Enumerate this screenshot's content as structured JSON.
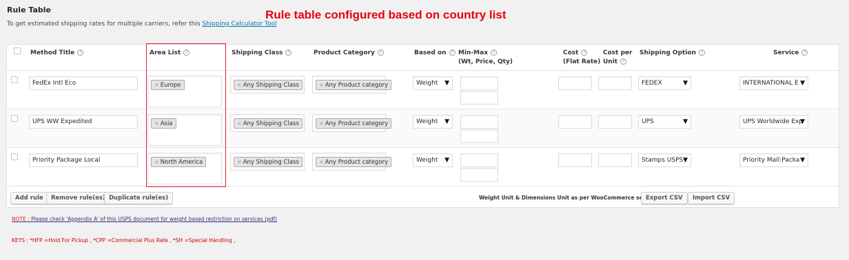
{
  "page": {
    "title": "Rule Table",
    "annotation": "Rule table configured based on country list",
    "description_prefix": "To get estimated shipping rates for multiple carriers, refer this ",
    "description_link": "Shipping Calculator Tool"
  },
  "table": {
    "headers": {
      "method_title": "Method Title",
      "area_list": "Area List",
      "shipping_class": "Shipping Class",
      "product_category": "Product Category",
      "based_on": "Based on",
      "min_max_line1": "Min-Max",
      "min_max_line2": "(Wt, Price, Qty)",
      "cost_line1": "Cost",
      "cost_line2": "(Flat Rate)",
      "cost_per_unit_line1": "Cost per",
      "cost_per_unit_line2": "Unit",
      "shipping_option": "Shipping Option",
      "service": "Service"
    },
    "help_glyph": "?",
    "rows": [
      {
        "method_title": "FedEx Intl Eco",
        "area": "Europe",
        "shipping_class": "Any Shipping Class",
        "product_category": "Any Product category",
        "based_on": "Weight",
        "shipping_option": "FEDEX",
        "service": "INTERNATIONAL E"
      },
      {
        "method_title": "UPS WW Expedited",
        "area": "Asia",
        "shipping_class": "Any Shipping Class",
        "product_category": "Any Product category",
        "based_on": "Weight",
        "shipping_option": "UPS",
        "service": "UPS Worldwide Exp"
      },
      {
        "method_title": "Priority Package Local",
        "area": "North America",
        "shipping_class": "Any Shipping Class",
        "product_category": "Any Product category",
        "based_on": "Weight",
        "shipping_option": "Stamps USPS",
        "service": "Priority Mail:Packa"
      }
    ],
    "tag_remove_glyph": "×",
    "dropdown_glyph": "▼"
  },
  "footer": {
    "add_rule": "Add rule",
    "remove_rules": "Remove rule(es)",
    "duplicate_rules": "Duplicate rule(es)",
    "unit_note": "Weight Unit & Dimensions Unit as per WooCommerce settings.",
    "export_csv": "Export CSV",
    "import_csv": "Import CSV"
  },
  "notes": {
    "note_label": "NOTE",
    "note_text": " : Please check 'Appendix A' of this USPS document for weight based restriction on services (pdf)",
    "keys": "KEYS : *HFP =Hold For Pickup , *CPP =Commercial Plus Rate , *SH =Special Handling ,"
  },
  "colors": {
    "annotation": "#e8000b",
    "highlight_border": "#d9232d",
    "link": "#0073aa"
  }
}
